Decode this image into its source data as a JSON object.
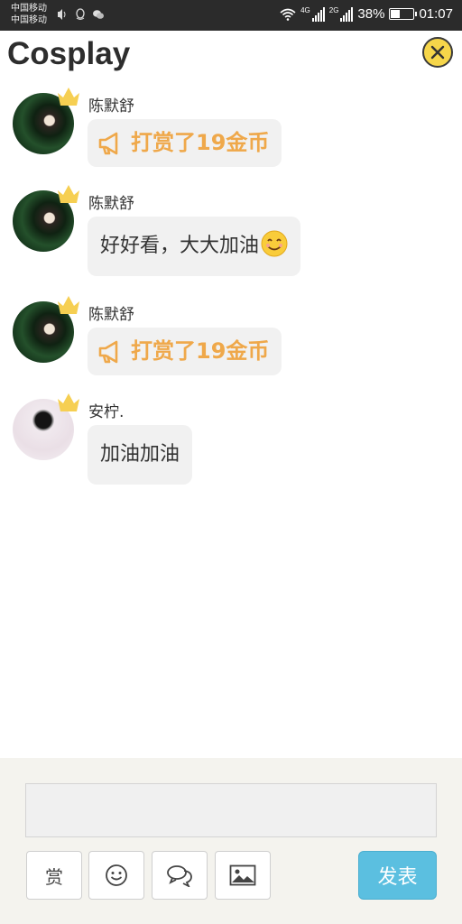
{
  "status_bar": {
    "carrier_1": "中国移动",
    "carrier_2": "中国移动",
    "net_1": "4G",
    "net_2": "2G",
    "battery": "38%",
    "battery_level": 0.38,
    "time": "01:07"
  },
  "header": {
    "title": "Cosplay",
    "close_icon": "close-icon"
  },
  "messages": [
    {
      "user": "陈默舒",
      "type": "reward",
      "text": "打赏了19金币",
      "avatar": "dark"
    },
    {
      "user": "陈默舒",
      "type": "text",
      "text": "好好看，大大加油",
      "emoji": "smiling-face-emoji",
      "avatar": "dark"
    },
    {
      "user": "陈默舒",
      "type": "reward",
      "text": "打赏了19金币",
      "avatar": "dark"
    },
    {
      "user": "安柠.",
      "type": "text",
      "text": "加油加油",
      "avatar": "light"
    }
  ],
  "composer": {
    "input_value": "",
    "reward_label": "赏",
    "send_label": "发表",
    "icons": [
      "reward-icon",
      "emoji-icon",
      "comment-icon",
      "image-icon"
    ]
  },
  "colors": {
    "reward_text": "#efa84a",
    "send_button": "#5bbfe0",
    "close_button": "#f6d64a",
    "crown": "#f6cf52"
  }
}
